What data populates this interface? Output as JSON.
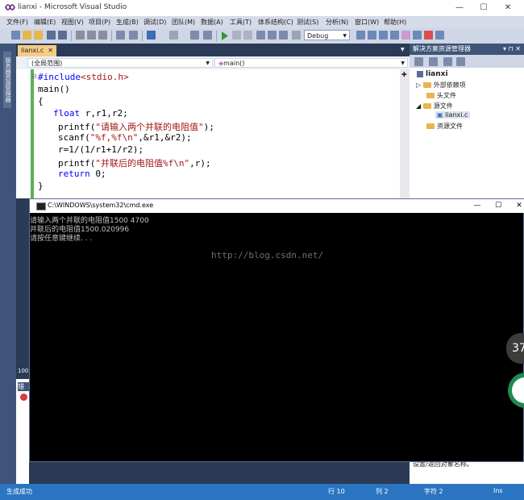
{
  "window": {
    "title": "lianxi - Microsoft Visual Studio"
  },
  "menu": {
    "items": [
      "文件(F)",
      "编辑(E)",
      "视图(V)",
      "项目(P)",
      "生成(B)",
      "调试(D)",
      "团队(M)",
      "数据(A)",
      "工具(T)",
      "体系结构(C)",
      "测试(S)",
      "分析(N)",
      "窗口(W)",
      "帮助(H)"
    ]
  },
  "toolbar": {
    "configuration": "Debug"
  },
  "editor": {
    "tab": "lianxi.c",
    "scope": "(全局范围)",
    "function": "main()",
    "code": {
      "l1_kw": "#include",
      "l1_str": "<stdio.h>",
      "l2": "main()",
      "l3": "{",
      "l4_kw": "float",
      "l4_rest": " r,r1,r2;",
      "l5_a": "printf(",
      "l5_str": "\"请输入两个并联的电阻值\"",
      "l5_b": ");",
      "l6_a": "scanf(",
      "l6_str": "\"%f,%f\\n\"",
      "l6_b": ",&r1,&r2);",
      "l7": "r=1/(1/r1+1/r2);",
      "l8_a": "printf(",
      "l8_str": "\"并联后的电阻值%f\\n\"",
      "l8_b": ",r);",
      "l9_kw": "return",
      "l9_rest": " 0;",
      "l10": "}"
    }
  },
  "left_strip": {
    "label": "服务器资源管理器"
  },
  "zoom": {
    "value": "100"
  },
  "output_tab": {
    "label": "错"
  },
  "solution_explorer": {
    "title": "解决方案资源管理器",
    "pin": "▾ ⊓ ✕",
    "project": "lianxi",
    "items": [
      "外部依赖项",
      "头文件",
      "源文件",
      "lianxi.c",
      "资源文件"
    ]
  },
  "properties": {
    "description": "设置/返回对象名称。"
  },
  "console": {
    "title": "C:\\WINDOWS\\system32\\cmd.exe",
    "lines": [
      "请输入两个并联的电阻值1500 4700",
      "并联后的电阻值1500.020996",
      "请按任意键继续. . ."
    ],
    "watermark": "http://blog.csdn.net/"
  },
  "status": {
    "message": "生成成功",
    "line": "行 10",
    "col": "列 2",
    "char": "字符 2",
    "mode": "Ins"
  },
  "overlay": {
    "number": "37"
  },
  "colors": {
    "vs_blue": "#2a74c2",
    "tab_gold": "#f5cc84",
    "keyword": "#0000ff",
    "string": "#a31515"
  }
}
